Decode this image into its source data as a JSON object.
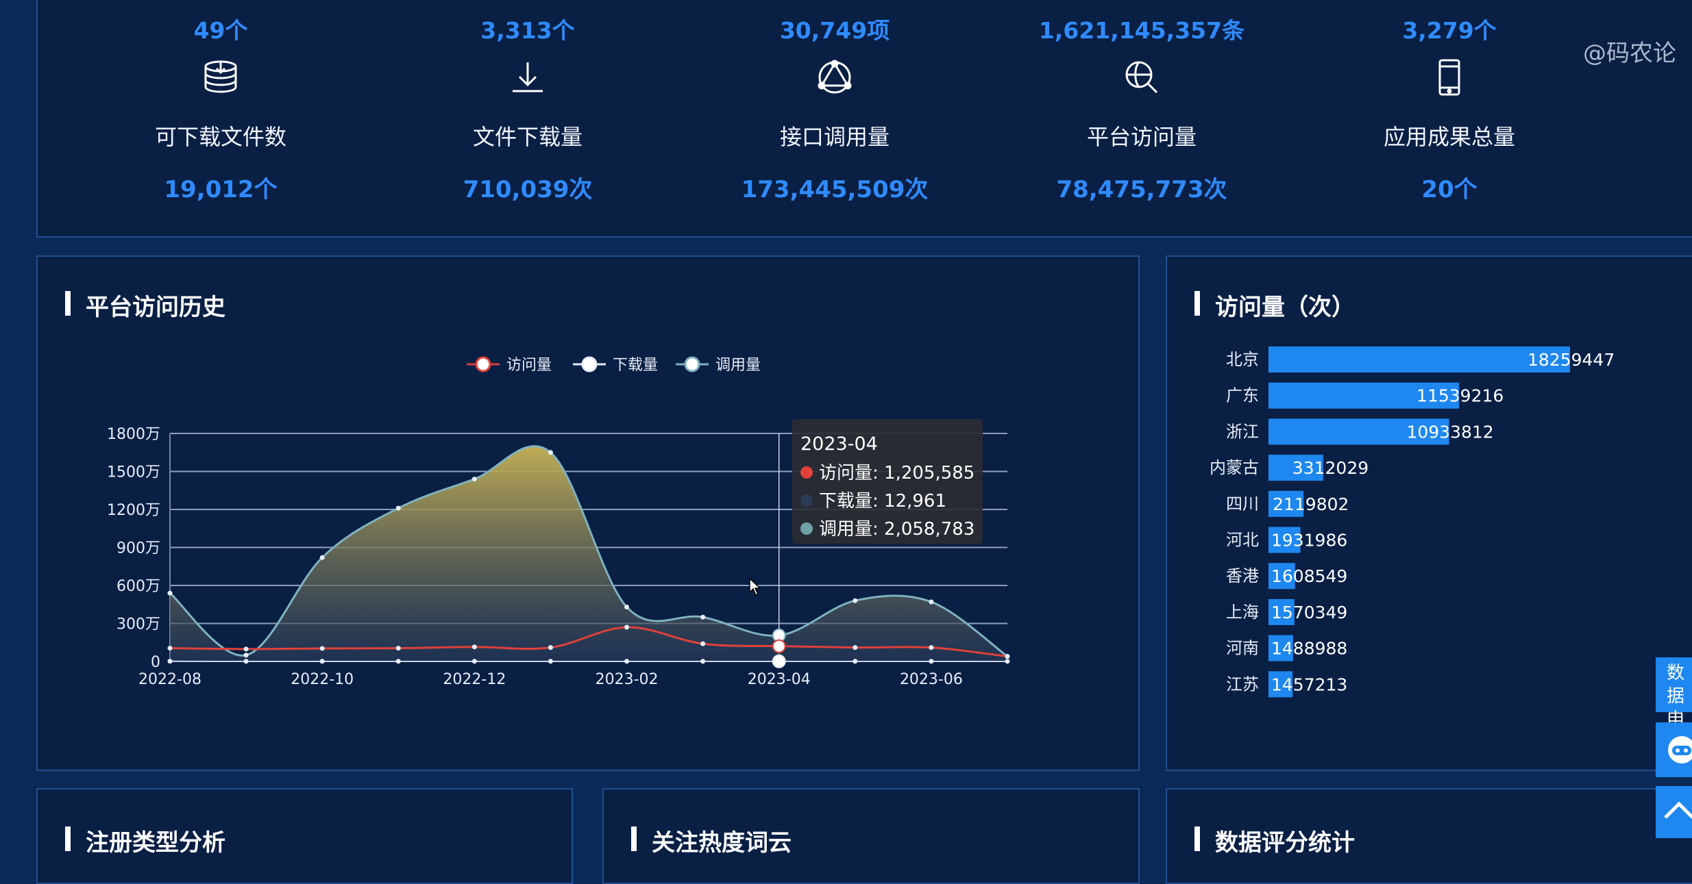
{
  "stats_top": [
    {
      "value": "49个"
    },
    {
      "value": "3,313个"
    },
    {
      "value": "30,749项"
    },
    {
      "value": "1,621,145,357条"
    },
    {
      "value": "3,279个"
    }
  ],
  "stats": [
    {
      "icon": "database-download-icon",
      "label": "可下载文件数",
      "value": "19,012个"
    },
    {
      "icon": "download-icon",
      "label": "文件下载量",
      "value": "710,039次"
    },
    {
      "icon": "api-triangle-icon",
      "label": "接口调用量",
      "value": "173,445,509次"
    },
    {
      "icon": "search-globe-icon",
      "label": "平台访问量",
      "value": "78,475,773次"
    },
    {
      "icon": "mobile-phone-icon",
      "label": "应用成果总量",
      "value": "20个"
    }
  ],
  "watermark": "@码农论",
  "history": {
    "title": "平台访问历史",
    "tooltip": {
      "date": "2023-04",
      "rows": [
        {
          "label": "访问量: 1,205,585",
          "color": "#e0413a"
        },
        {
          "label": "下载量: 12,961",
          "color": "#2b3a55"
        },
        {
          "label": "调用量: 2,058,783",
          "color": "#6fa2a6"
        }
      ]
    }
  },
  "chart_data": [
    {
      "type": "area",
      "x": [
        "2022-08",
        "2022-09",
        "2022-10",
        "2022-11",
        "2022-12",
        "2023-01",
        "2023-02",
        "2023-03",
        "2023-04",
        "2023-05",
        "2023-06",
        "2023-07"
      ],
      "x_tick_labels": [
        "2022-08",
        "2022-10",
        "2022-12",
        "2023-02",
        "2023-04",
        "2023-06"
      ],
      "y_tick_labels": [
        "0",
        "300万",
        "600万",
        "900万",
        "1200万",
        "1500万",
        "1800万"
      ],
      "ylim": [
        0,
        18000000
      ],
      "series": [
        {
          "name": "访问量",
          "color": "#e0413a",
          "values": [
            1050000,
            980000,
            1030000,
            1050000,
            1150000,
            1100000,
            2700000,
            1400000,
            1205585,
            1100000,
            1100000,
            400000
          ]
        },
        {
          "name": "下载量",
          "color": "#e8eef8",
          "values": [
            20000,
            15000,
            15000,
            15000,
            15000,
            15000,
            15000,
            15000,
            12961,
            15000,
            15000,
            10000
          ]
        },
        {
          "name": "调用量",
          "color": "#7fb3bf",
          "values": [
            5400000,
            500000,
            8200000,
            12100000,
            14400000,
            16500000,
            4300000,
            3500000,
            2058783,
            4800000,
            4700000,
            400000
          ]
        }
      ],
      "grid": true,
      "legend": "top-center"
    },
    {
      "type": "bar",
      "title": "访问量（次）",
      "orientation": "horizontal",
      "categories": [
        "北京",
        "广东",
        "浙江",
        "内蒙古",
        "四川",
        "河北",
        "香港",
        "上海",
        "河南",
        "江苏"
      ],
      "values": [
        18259447,
        11539216,
        10933812,
        3312029,
        2119802,
        1931986,
        1608549,
        1570349,
        1488988,
        1457213
      ],
      "color": "#1e88f0"
    }
  ],
  "bottom_panels": {
    "registration": "注册类型分析",
    "wordcloud": "关注热度词云",
    "rating": "数据评分统计"
  },
  "side": {
    "apply": "数据申请"
  }
}
